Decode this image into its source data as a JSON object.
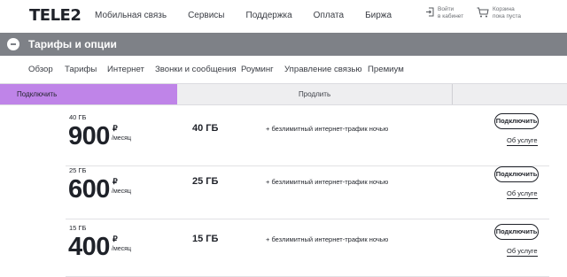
{
  "header": {
    "logo": "TELE2",
    "nav": [
      "Мобильная связь",
      "Сервисы",
      "Поддержка",
      "Оплата",
      "Биржа"
    ],
    "login": {
      "line1": "Войти",
      "line2": "в кабинет",
      "icon": "login-icon"
    },
    "cart": {
      "line1": "Корзина",
      "line2": "пока пуста",
      "icon": "cart-icon"
    }
  },
  "titlebar": {
    "title": "Тарифы и опции",
    "back_icon": "back-icon"
  },
  "subnav": [
    "Обзор",
    "Тарифы",
    "Интернет",
    "Звонки и сообщения",
    "Роуминг",
    "Управление связью",
    "Премиум"
  ],
  "segments": {
    "active": "Подключить",
    "inactive": "Продлить",
    "active_color": "#bf84e8"
  },
  "rows": [
    {
      "volume": "40 ГБ",
      "price": "900",
      "currency": "₽",
      "period": "/месяц",
      "gb": "40 ГБ",
      "feature": "+ безлимитный интернет-трафик ночью",
      "button": "Подключить",
      "link": "Об услуге"
    },
    {
      "volume": "25 ГБ",
      "price": "600",
      "currency": "₽",
      "period": "/месяц",
      "gb": "25 ГБ",
      "feature": "+ безлимитный интернет-трафик ночью",
      "button": "Подключить",
      "link": "Об услуге"
    },
    {
      "volume": "15 ГБ",
      "price": "400",
      "currency": "₽",
      "period": "/месяц",
      "gb": "15 ГБ",
      "feature": "+ безлимитный интернет-трафик ночью",
      "button": "Подключить",
      "link": "Об услуге"
    }
  ]
}
